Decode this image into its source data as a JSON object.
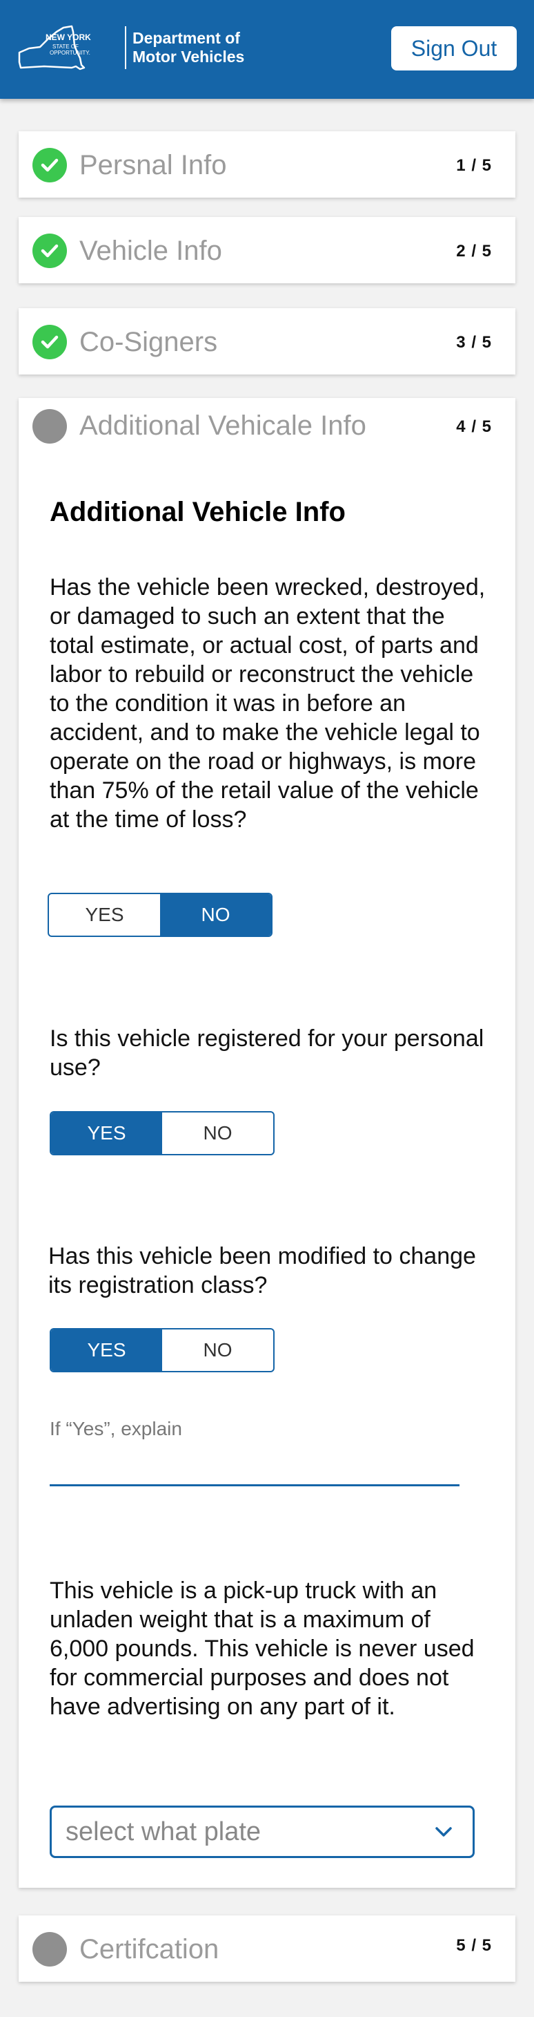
{
  "header": {
    "logo": {
      "line1": "NEW YORK",
      "line2": "STATE OF",
      "line3": "OPPORTUNITY."
    },
    "department_line1": "Department of",
    "department_line2": "Motor Vehicles",
    "signout_label": "Sign Out",
    "background_color": "#1565a8"
  },
  "steps": [
    {
      "title": "Persnal Info",
      "count": "1 / 5",
      "status": "complete",
      "icon": "check-icon"
    },
    {
      "title": "Vehicle Info",
      "count": "2 / 5",
      "status": "complete",
      "icon": "check-icon"
    },
    {
      "title": "Co-Signers",
      "count": "3 / 5",
      "status": "complete",
      "icon": "check-icon"
    },
    {
      "title": "Additional Vehicale Info",
      "count": "4 / 5",
      "status": "current",
      "icon": "pending-circle-icon"
    },
    {
      "title": "Certifcation",
      "count": "5 / 5",
      "status": "pending",
      "icon": "pending-circle-icon"
    }
  ],
  "form": {
    "heading": "Additional Vehicle Info",
    "questions": [
      {
        "text": "Has the vehicle been wrecked, destroyed, or damaged to such an extent that the total estimate, or actual cost, of parts and labor to rebuild or reconstruct the vehicle to the condition it was in before an accident, and to make the vehicle legal to operate on the road or highways, is more than 75% of the retail value of the vehicle at the time of loss?",
        "yes_label": "YES",
        "no_label": "NO",
        "selected": "NO"
      },
      {
        "text": "Is this vehicle registered for your personal use?",
        "yes_label": "YES",
        "no_label": "NO",
        "selected": "YES"
      },
      {
        "text": "Has this vehicle been modified to change its registration class?",
        "yes_label": "YES",
        "no_label": "NO",
        "selected": "YES"
      }
    ],
    "explain_label": "If “Yes”, explain",
    "explain_value": "",
    "description": "This vehicle is a pick-up truck with an unladen weight that is a maximum of 6,000 pounds. This vehicle is never used for commercial purposes and does not have advertising on any part of it.",
    "plate_select": {
      "placeholder": "select what plate",
      "icon": "chevron-down-icon"
    }
  },
  "colors": {
    "primary": "#1565a8",
    "complete": "#3bc74f",
    "pending": "#8f8f8f",
    "page_background": "#f2f2f2"
  }
}
